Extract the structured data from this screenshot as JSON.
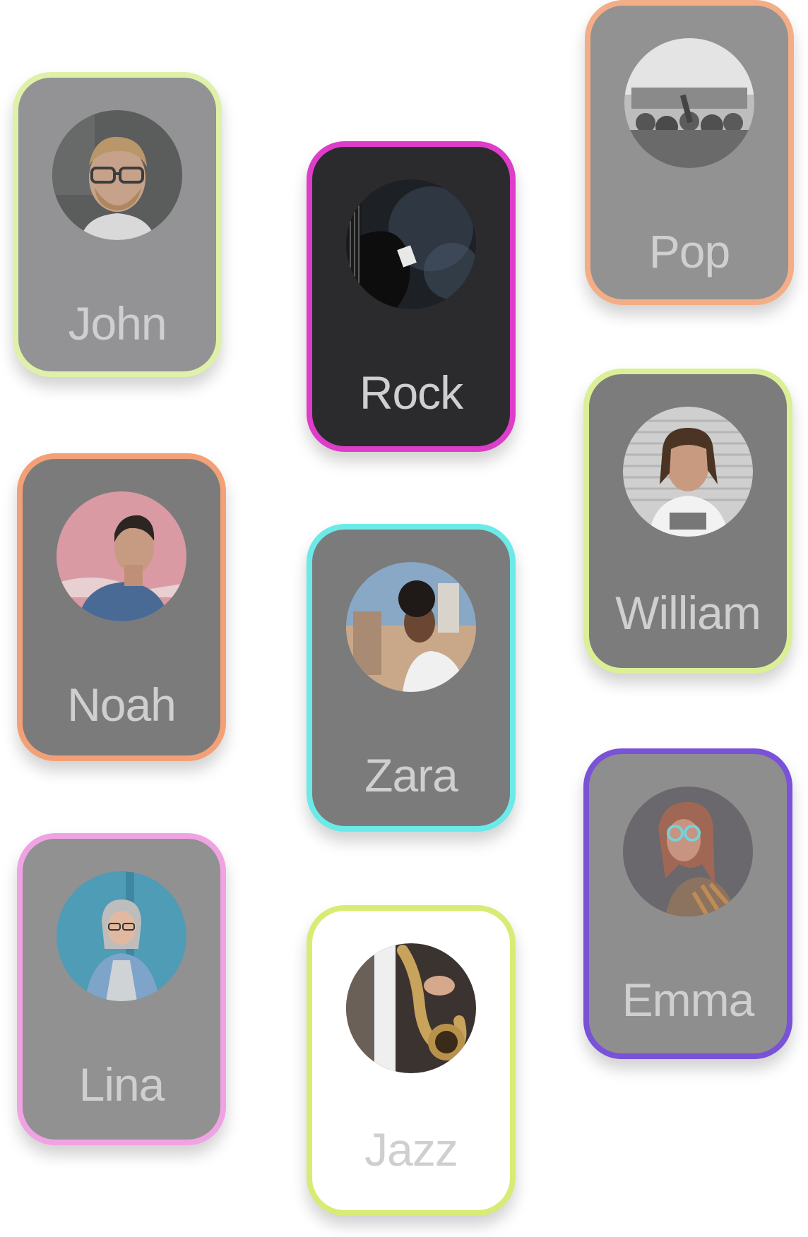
{
  "cards": [
    {
      "label": "John",
      "icon": "portrait-john-icon",
      "border_color": "#dff1a9"
    },
    {
      "label": "Rock",
      "icon": "guitar-genre-icon",
      "border_color": "#dd3dc9"
    },
    {
      "label": "Pop",
      "icon": "concert-crowd-icon",
      "border_color": "#f3ae87"
    },
    {
      "label": "Noah",
      "icon": "portrait-noah-icon",
      "border_color": "#f3a077"
    },
    {
      "label": "William",
      "icon": "portrait-william-icon",
      "border_color": "#dbef97"
    },
    {
      "label": "Zara",
      "icon": "portrait-zara-icon",
      "border_color": "#6beae8"
    },
    {
      "label": "Lina",
      "icon": "portrait-lina-icon",
      "border_color": "#f0a3e3"
    },
    {
      "label": "Emma",
      "icon": "portrait-emma-icon",
      "border_color": "#7a52d8"
    },
    {
      "label": "Jazz",
      "icon": "saxophone-genre-icon",
      "border_color": "#d7ec75"
    }
  ]
}
